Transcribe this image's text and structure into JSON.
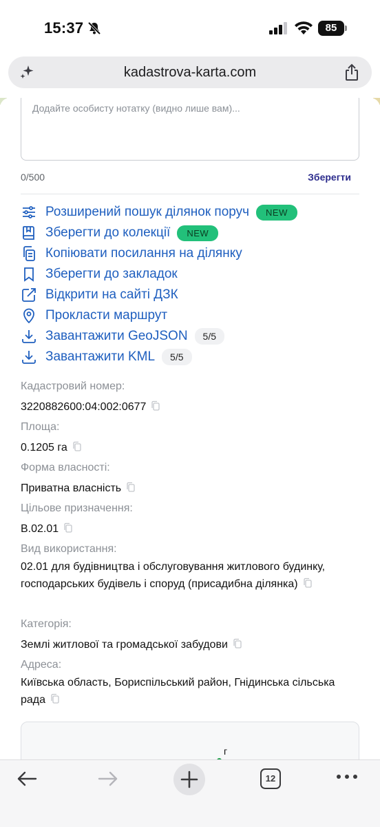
{
  "status": {
    "time": "15:37",
    "battery": "85"
  },
  "browser": {
    "url": "kadastrova-karta.com"
  },
  "note": {
    "placeholder": "Додайте особисту нотатку (видно лише вам)...",
    "counter": "0/500",
    "save_label": "Зберегти"
  },
  "actions": [
    {
      "label": "Розширений пошук ділянок поруч",
      "badge": "NEW",
      "icon": "sliders-icon"
    },
    {
      "label": "Зберегти до колекції",
      "badge": "NEW",
      "icon": "collection-icon"
    },
    {
      "label": "Копіювати посилання на ділянку",
      "icon": "copy-link-icon"
    },
    {
      "label": "Зберегти до закладок",
      "icon": "bookmark-icon"
    },
    {
      "label": "Відкрити на сайті ДЗК",
      "icon": "external-link-icon"
    },
    {
      "label": "Прокласти маршрут",
      "icon": "location-pin-icon"
    },
    {
      "label": "Завантажити GeoJSON",
      "count": "5/5",
      "icon": "download-icon"
    },
    {
      "label": "Завантажити KML",
      "count": "5/5",
      "icon": "download-icon"
    }
  ],
  "fields": [
    {
      "label": "Кадастровий номер:",
      "value": "3220882600:04:002:0677"
    },
    {
      "label": "Площа:",
      "value": "0.1205 га"
    },
    {
      "label": "Форма власності:",
      "value": "Приватна власність"
    },
    {
      "label": "Цільове призначення:",
      "value": "В.02.01"
    },
    {
      "label": "Вид використання:",
      "value": "02.01 для будівництва і обслуговування житлового будинку, господарських будівель і споруд (присадибна ділянка)"
    },
    {
      "label": "Категорія:",
      "value": "Землі житлової та громадської забудови"
    },
    {
      "label": "Адреса:",
      "value": "Київська область, Бориспільський район, Гнідинська сільська рада"
    }
  ],
  "map": {
    "letter": "г"
  },
  "toolbar": {
    "tabs_count": "12"
  },
  "colors": {
    "link": "#1f5fbf",
    "badge_new": "#22c07a",
    "save": "#2b2b8c"
  }
}
